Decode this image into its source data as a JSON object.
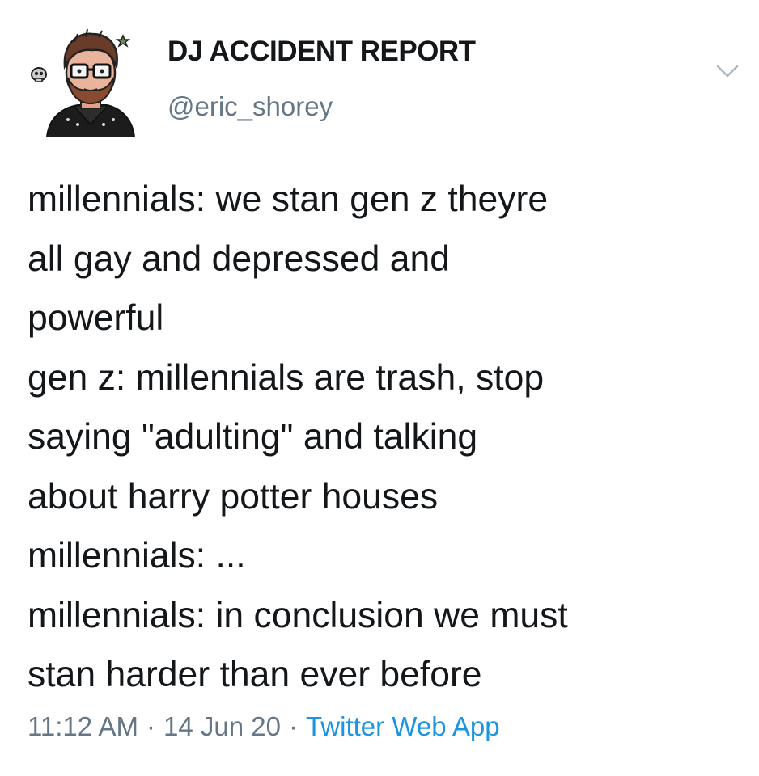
{
  "tweet": {
    "author": {
      "display_name": "DJ ACCIDENT REPORT",
      "handle": "@eric_shorey",
      "avatar_icon": "cartoon-avatar-bearded-glasses",
      "menu_icon": "chevron-down-icon"
    },
    "text_lines": [
      "millennials: we stan gen z theyre",
      "all gay and depressed and",
      "powerful",
      "gen z: millennials are trash, stop",
      "saying \"adulting\" and talking",
      "about harry potter houses",
      "millennials: ...",
      "millennials: in conclusion we must",
      "stan harder than ever before"
    ],
    "meta": {
      "time": "11:12 AM",
      "separator": "·",
      "date": "14 Jun 20",
      "source": "Twitter Web App"
    }
  },
  "colors": {
    "text": "#14171a",
    "secondary": "#657786",
    "link": "#1b95e0",
    "background": "#ffffff"
  }
}
